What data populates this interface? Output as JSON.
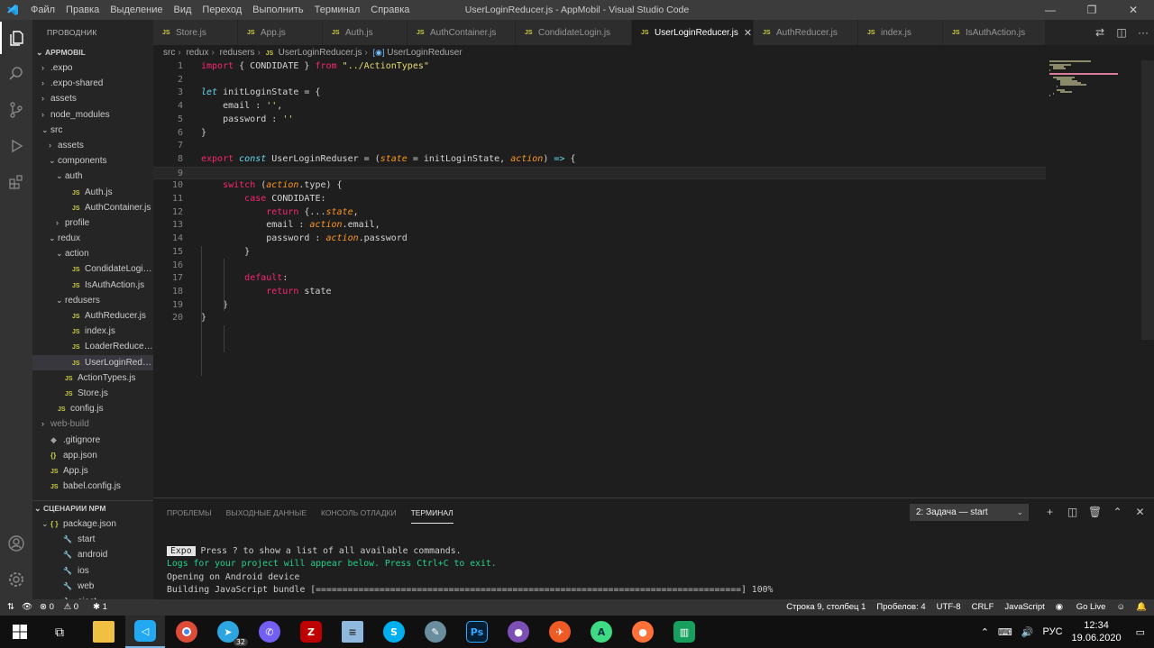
{
  "window": {
    "title": "UserLoginReducer.js - AppMobil - Visual Studio Code",
    "menu": [
      "Файл",
      "Правка",
      "Выделение",
      "Вид",
      "Переход",
      "Выполнить",
      "Терминал",
      "Справка"
    ]
  },
  "sidebar": {
    "title": "ПРОВОДНИК",
    "project": "APPMOBIL",
    "tree": [
      {
        "label": ".expo",
        "depth": 1,
        "kind": "folder",
        "open": false
      },
      {
        "label": ".expo-shared",
        "depth": 1,
        "kind": "folder",
        "open": false
      },
      {
        "label": "assets",
        "depth": 1,
        "kind": "folder",
        "open": false
      },
      {
        "label": "node_modules",
        "depth": 1,
        "kind": "folder",
        "open": false
      },
      {
        "label": "src",
        "depth": 1,
        "kind": "folder",
        "open": true
      },
      {
        "label": "assets",
        "depth": 2,
        "kind": "folder",
        "open": false
      },
      {
        "label": "components",
        "depth": 2,
        "kind": "folder",
        "open": true
      },
      {
        "label": "auth",
        "depth": 3,
        "kind": "folder",
        "open": true
      },
      {
        "label": "Auth.js",
        "depth": 4,
        "kind": "js"
      },
      {
        "label": "AuthContainer.js",
        "depth": 4,
        "kind": "js"
      },
      {
        "label": "profile",
        "depth": 3,
        "kind": "folder",
        "open": false
      },
      {
        "label": "redux",
        "depth": 2,
        "kind": "folder",
        "open": true
      },
      {
        "label": "action",
        "depth": 3,
        "kind": "folder",
        "open": true
      },
      {
        "label": "CondidateLogin.js",
        "depth": 4,
        "kind": "js"
      },
      {
        "label": "IsAuthAction.js",
        "depth": 4,
        "kind": "js"
      },
      {
        "label": "redusers",
        "depth": 3,
        "kind": "folder",
        "open": true
      },
      {
        "label": "AuthReducer.js",
        "depth": 4,
        "kind": "js"
      },
      {
        "label": "index.js",
        "depth": 4,
        "kind": "js"
      },
      {
        "label": "LoaderReducer.js",
        "depth": 4,
        "kind": "js"
      },
      {
        "label": "UserLoginReducer.js",
        "depth": 4,
        "kind": "js",
        "selected": true
      },
      {
        "label": "ActionTypes.js",
        "depth": 3,
        "kind": "js"
      },
      {
        "label": "Store.js",
        "depth": 3,
        "kind": "js"
      },
      {
        "label": "config.js",
        "depth": 2,
        "kind": "js"
      },
      {
        "label": "web-build",
        "depth": 1,
        "kind": "folder",
        "open": false,
        "dim": true
      },
      {
        "label": ".gitignore",
        "depth": 1,
        "kind": "git"
      },
      {
        "label": "app.json",
        "depth": 1,
        "kind": "json"
      },
      {
        "label": "App.js",
        "depth": 1,
        "kind": "js"
      },
      {
        "label": "babel.config.js",
        "depth": 1,
        "kind": "js"
      }
    ],
    "npm": {
      "title": "СЦЕНАРИИ NPM",
      "file": "package.json",
      "scripts": [
        "start",
        "android",
        "ios",
        "web",
        "eject"
      ]
    }
  },
  "tabs": [
    {
      "label": "Store.js"
    },
    {
      "label": "App.js"
    },
    {
      "label": "Auth.js"
    },
    {
      "label": "AuthContainer.js"
    },
    {
      "label": "CondidateLogin.js"
    },
    {
      "label": "UserLoginReducer.js",
      "active": true
    },
    {
      "label": "AuthReducer.js"
    },
    {
      "label": "index.js"
    },
    {
      "label": "IsAuthAction.js"
    }
  ],
  "breadcrumb": [
    "src",
    "redux",
    "redusers",
    "UserLoginReducer.js",
    "UserLoginReduser"
  ],
  "editor": {
    "current_line": 9,
    "lines": [
      "import { CONDIDATE } from \"../ActionTypes\"",
      "",
      "let initLoginState = {",
      "    email : '',",
      "    password : ''",
      "}",
      "",
      "export const UserLoginReduser = (state = initLoginState, action) => {",
      "",
      "    switch (action.type) {",
      "        case CONDIDATE:",
      "            return {...state,",
      "            email : action.email,",
      "            password : action.password",
      "        }",
      "",
      "        default:",
      "            return state",
      "    }",
      "}"
    ]
  },
  "panel": {
    "tabs": [
      "ПРОБЛЕМЫ",
      "ВЫХОДНЫЕ ДАННЫЕ",
      "КОНСОЛЬ ОТЛАДКИ",
      "ТЕРМИНАЛ"
    ],
    "active_tab": "ТЕРМИНАЛ",
    "terminal_select": "2: Задача — start",
    "terminal": {
      "badge": "Expo",
      "line1": " Press ? to show a list of all available commands.",
      "line2": "Logs for your project will appear below. Press Ctrl+C to exit.",
      "line3": "Opening on Android device",
      "line4": "Building JavaScript bundle [================================================================================] 100%"
    }
  },
  "statusbar": {
    "errors": "0",
    "warnings": "0",
    "live_share": "1",
    "position": "Строка 9, столбец 1",
    "spaces": "Пробелов: 4",
    "encoding": "UTF-8",
    "eol": "CRLF",
    "language": "JavaScript",
    "go_live": "Go Live"
  },
  "taskbar": {
    "language": "РУС",
    "time": "12:34",
    "date": "19.06.2020",
    "telegram_badge": "32"
  }
}
